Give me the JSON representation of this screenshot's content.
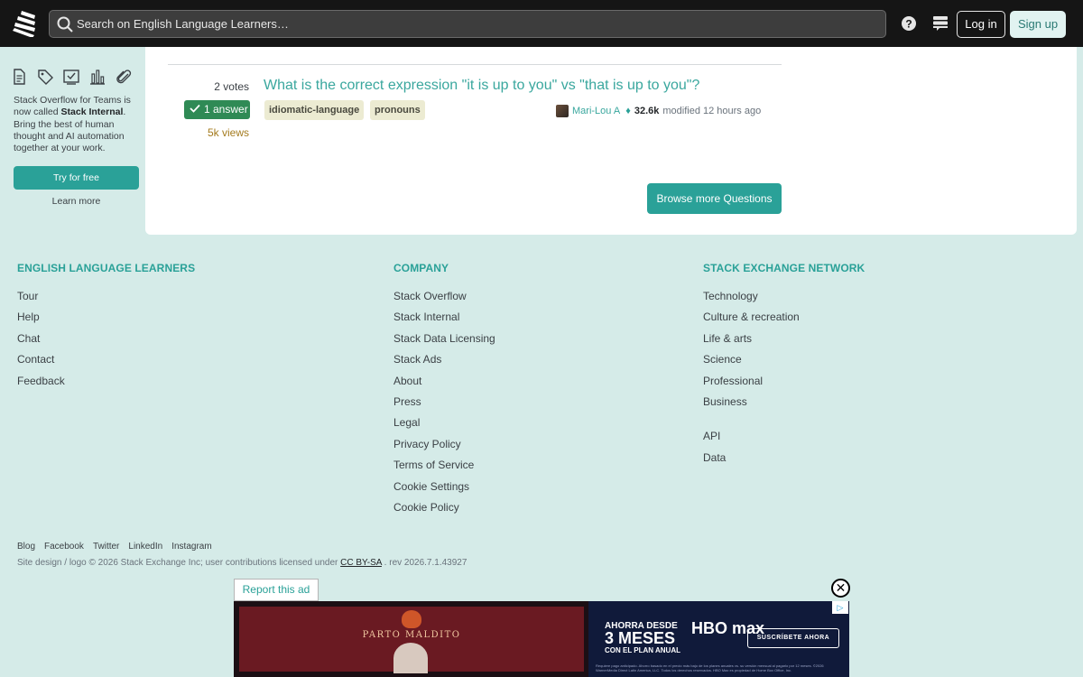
{
  "header": {
    "search_placeholder": "Search on English Language Learners…",
    "login_label": "Log in",
    "signup_label": "Sign up"
  },
  "sidebar": {
    "icons": [
      "document-icon",
      "tag-icon",
      "review-icon",
      "chart-icon",
      "paperclip-icon"
    ],
    "teams_text_1": "Stack Overflow for Teams is now called ",
    "teams_text_bold": "Stack Internal",
    "teams_text_2": ". Bring the best of human thought and AI automation together at your work.",
    "try_label": "Try for free",
    "learn_label": "Learn more"
  },
  "question": {
    "votes": "2 votes",
    "answers": "1 answer",
    "views": "5k views",
    "title": "What is the correct expression \"it is up to you\" vs \"that is up to you\"?",
    "tags": [
      "idiomatic-language",
      "pronouns"
    ],
    "user": "Mari-Lou A",
    "reputation": "32.6k",
    "modified": "modified 12 hours ago"
  },
  "browse_label": "Browse more Questions",
  "footer": {
    "col1": {
      "heading": "ENGLISH LANGUAGE LEARNERS",
      "items": [
        "Tour",
        "Help",
        "Chat",
        "Contact",
        "Feedback"
      ]
    },
    "col2": {
      "heading": "COMPANY",
      "items": [
        "Stack Overflow",
        "Stack Internal",
        "Stack Data Licensing",
        "Stack Ads",
        "About",
        "Press",
        "Legal",
        "Privacy Policy",
        "Terms of Service",
        "Cookie Settings",
        "Cookie Policy"
      ]
    },
    "col3": {
      "heading": "STACK EXCHANGE NETWORK",
      "items": [
        "Technology",
        "Culture & recreation",
        "Life & arts",
        "Science",
        "Professional",
        "Business"
      ],
      "items2": [
        "API",
        "Data"
      ]
    },
    "social": [
      "Blog",
      "Facebook",
      "Twitter",
      "LinkedIn",
      "Instagram"
    ],
    "copyright_pre": "Site design / logo © 2026 Stack Exchange Inc; user contributions licensed under ",
    "license": "CC BY-SA",
    "copyright_post": " . rev 2026.7.1.43927"
  },
  "ad": {
    "report_label": "Report this ad",
    "film_title": "PARTO MALDITO",
    "promo_1": "AHORRA DESDE",
    "promo_2": "3 MESES",
    "promo_3": "CON EL PLAN ANUAL",
    "brand": "HBO max",
    "cta": "SUSCRÍBETE AHORA",
    "fine_print": "Requiere pago anticipado. Ahorro basado en el precio más bajo de los planes anuales vs. su versión mensual al pagarlo por 12 meses. ©2026 WarnerMedia Direct Latin America, LLC. Todos los derechos reservados. HBO Max es propiedad de Home Box Office, Inc.",
    "close_glyph": "✕",
    "choices_glyph": "▷"
  }
}
